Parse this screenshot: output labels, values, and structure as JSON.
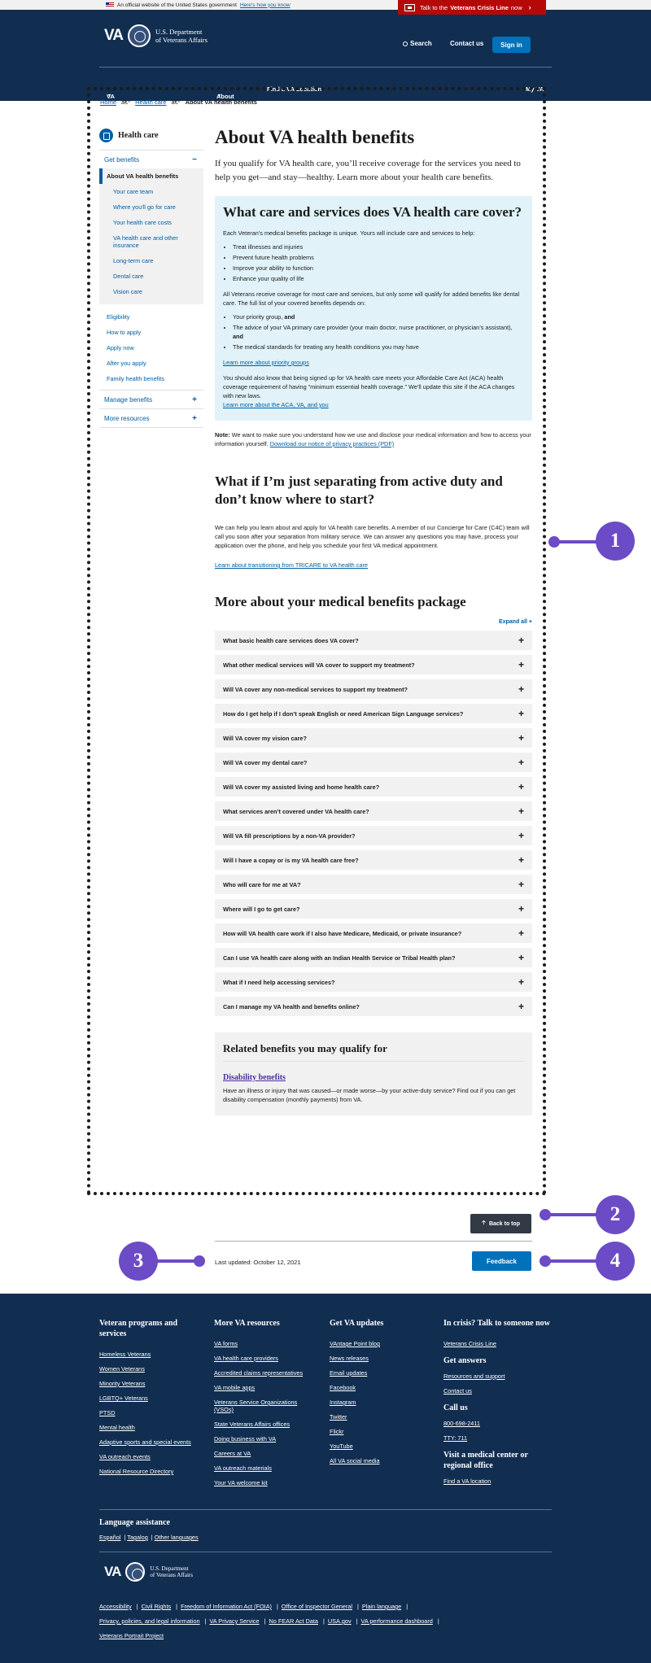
{
  "banner": {
    "official": "An official website of the United States government",
    "how": "Here's how you know"
  },
  "crisis": {
    "pre": "Talk to the",
    "bold": "Veterans Crisis Line",
    "post": "now"
  },
  "header": {
    "logo_va": "VA",
    "dept_line1": "U.S. Department",
    "dept_line2": "of Veterans Affairs",
    "search": "Search",
    "contact": "Contact us",
    "signin": "Sign in"
  },
  "nav": {
    "benefits": "VA Benefits and Health Care",
    "about": "About VA",
    "find": "Find a VA Location",
    "myva": "My VA"
  },
  "breadcrumbs": {
    "home": "Home",
    "sep": "â€º",
    "health": "Health care",
    "current": "About VA health benefits"
  },
  "sidebar": {
    "title": "Health care",
    "get_benefits": "Get benefits",
    "collapse": "−",
    "current": "About VA health benefits",
    "sub": [
      "Your care team",
      "Where you'll go for care",
      "Your health care costs",
      "VA health care and other insurance",
      "Long-term care",
      "Dental care",
      "Vision care"
    ],
    "plain": [
      "Eligibility",
      "How to apply",
      "Apply now",
      "After you apply",
      "Family health benefits"
    ],
    "manage": "Manage benefits",
    "more": "More resources",
    "expand": "+"
  },
  "main": {
    "title": "About VA health benefits",
    "intro": "If you qualify for VA health care, you’ll receive coverage for the services you need to help you get—and stay—healthy. Learn more about your health care benefits.",
    "callout": {
      "heading": "What care and services does VA health care cover?",
      "p1": "Each Veteran’s medical benefits package is unique. Yours will include care and services to help:",
      "list1": [
        "Treat illnesses and injuries",
        "Prevent future health problems",
        "Improve your ability to function",
        "Enhance your quality of life"
      ],
      "p2": "All Veterans receive coverage for most care and services, but only some will qualify for added benefits like dental care. The full list of your covered benefits depends on:",
      "list2a": "Your priority group,",
      "list2b": "The advice of your VA primary care provider (your main doctor, nurse practitioner, or physician’s assistant),",
      "and": "and",
      "list2c": "The medical standards for treating any health conditions you may have",
      "link1": "Learn more about priority groups",
      "p3": "You should also know that being signed up for VA health care meets your Affordable Care Act (ACA) health coverage requirement of having “minimum essential health coverage.” We’ll update this site if the ACA changes with new laws.",
      "link2": "Learn more about the ACA, VA, and you"
    },
    "note_label": "Note:",
    "note_text": "We want to make sure you understand how we use and disclose your medical information and how to access your information yourself.",
    "note_link": "Download our notice of privacy practices (PDF)",
    "sep_heading": "What if I’m just separating from active duty and don’t know where to start?",
    "sep_para": "We can help you learn about and apply for VA health care benefits. A member of our Concierge for Care (C4C) team will call you soon after your separation from military service. We can answer any questions you may have, process your application over the phone, and help you schedule your first VA medical appointment.",
    "sep_link": "Learn about transitioning from TRICARE to VA health care",
    "more_heading": "More about your medical benefits package",
    "expand_all": "Expand all +",
    "accordion": [
      "What basic health care services does VA cover?",
      "What other medical services will VA cover to support my treatment?",
      "Will VA cover any non-medical services to support my treatment?",
      "How do I get help if I don’t speak English or need American Sign Language services?",
      "Will VA cover my vision care?",
      "Will VA cover my dental care?",
      "Will VA cover my assisted living and home health care?",
      "What services aren’t covered under VA health care?",
      "Will VA fill prescriptions by a non-VA provider?",
      "Will I have a copay or is my VA health care free?",
      "Who will care for me at VA?",
      "Where will I go to get care?",
      "How will VA health care work if I also have Medicare, Medicaid, or private insurance?",
      "Can I use VA health care along with an Indian Health Service or Tribal Health plan?",
      "What if I need help accessing services?",
      "Can I manage my VA health and benefits online?"
    ],
    "plus": "+",
    "related_heading": "Related benefits you may qualify for",
    "related_link": "Disability benefits",
    "related_text": "Have an illness or injury that was caused—or made worse—by your active-duty service? Find out if you can get disability compensation (monthly payments) from VA."
  },
  "bottom": {
    "back_to_top": "Back to top",
    "updated": "Last updated: October 12, 2021",
    "feedback": "Feedback"
  },
  "markers": [
    "1",
    "2",
    "3",
    "4"
  ],
  "footer": {
    "col1": {
      "heading": "Veteran programs and services",
      "links": [
        "Homeless Veterans",
        "Women Veterans",
        "Minority Veterans",
        "LGBTQ+ Veterans",
        "PTSD",
        "Mental health",
        "Adaptive sports and special events",
        "VA outreach events",
        "National Resource Directory"
      ]
    },
    "col2": {
      "heading": "More VA resources",
      "links": [
        "VA forms",
        "VA health care providers",
        "Accredited claims representatives",
        "VA mobile apps",
        "Veterans Service Organizations (VSOs)",
        "State Veterans Affairs offices",
        "Doing business with VA",
        "Careers at VA",
        "VA outreach materials",
        "Your VA welcome kit"
      ]
    },
    "col3": {
      "heading": "Get VA updates",
      "links": [
        "VAntage Point blog",
        "News releases",
        "Email updates",
        "Facebook",
        "Instagram",
        "Twitter",
        "Flickr",
        "YouTube",
        "All VA social media"
      ]
    },
    "col4": {
      "heading": "In crisis? Talk to someone now",
      "crisis_link": "Veterans Crisis Line",
      "answers": "Get answers",
      "answers_links": [
        "Resources and support",
        "Contact us"
      ],
      "call": "Call us",
      "phone": "800-698-2411",
      "tty": "TTY: 711",
      "visit": "Visit a medical center or regional office",
      "find": "Find a VA location"
    },
    "lang_heading": "Language assistance",
    "languages": [
      "Español",
      "Tagalog",
      "Other languages"
    ],
    "legal": [
      "Accessibility",
      "Civil Rights",
      "Freedom of Information Act (FOIA)",
      "Office of Inspector General",
      "Plain language",
      "Privacy, policies, and legal information",
      "VA Privacy Service",
      "No FEAR Act Data",
      "USA.gov",
      "VA performance dashboard",
      "Veterans Portrait Project"
    ]
  }
}
